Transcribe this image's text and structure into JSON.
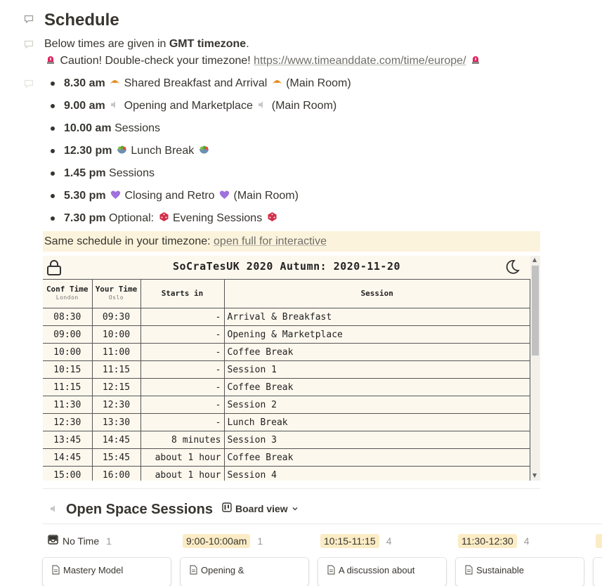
{
  "page": {
    "title": "Schedule",
    "intro_prefix": "Below times are given in ",
    "intro_bold": "GMT timezone",
    "intro_suffix": ".",
    "caution_text": "Caution! Double-check your timezone! ",
    "caution_link": "https://www.timeanddate.com/time/europe/"
  },
  "schedule": [
    {
      "time": "8.30 am",
      "pre": "",
      "text": "Shared Breakfast and Arrival",
      "icon": "croissant-icon",
      "room": "(Main Room)"
    },
    {
      "time": "9.00 am",
      "pre": "",
      "text": "Opening and Marketplace",
      "icon": "speaker-icon",
      "room": "(Main Room)"
    },
    {
      "time": "10.00 am",
      "pre": "",
      "text": "Sessions",
      "icon": "",
      "room": ""
    },
    {
      "time": "12.30 pm",
      "pre": "",
      "text": "Lunch Break",
      "icon": "salad-icon",
      "room": ""
    },
    {
      "time": "1.45 pm",
      "pre": "",
      "text": "Sessions",
      "icon": "",
      "room": ""
    },
    {
      "time": "5.30 pm",
      "pre": "",
      "text": "Closing and Retro",
      "icon": "purple-heart-icon",
      "room": "(Main Room)"
    },
    {
      "time": "7.30 pm",
      "pre": "Optional:",
      "text": "Evening Sessions",
      "icon": "dice-icon",
      "room": ""
    }
  ],
  "callout": {
    "text": "Same schedule in your timezone: ",
    "link": "open full for interactive"
  },
  "embed": {
    "title": "SoCraTesUK 2020 Autumn: 2020-11-20",
    "headers": {
      "conf_time": "Conf Time",
      "conf_sub": "London",
      "your_time": "Your Time",
      "your_sub": "Oslo",
      "starts_in": "Starts in",
      "session": "Session"
    },
    "rows": [
      {
        "conf": "08:30",
        "yours": "09:30",
        "starts": "-",
        "session": "Arrival & Breakfast"
      },
      {
        "conf": "09:00",
        "yours": "10:00",
        "starts": "-",
        "session": "Opening & Marketplace"
      },
      {
        "conf": "10:00",
        "yours": "11:00",
        "starts": "-",
        "session": "Coffee Break"
      },
      {
        "conf": "10:15",
        "yours": "11:15",
        "starts": "-",
        "session": "Session 1"
      },
      {
        "conf": "11:15",
        "yours": "12:15",
        "starts": "-",
        "session": "Coffee Break"
      },
      {
        "conf": "11:30",
        "yours": "12:30",
        "starts": "-",
        "session": "Session 2"
      },
      {
        "conf": "12:30",
        "yours": "13:30",
        "starts": "-",
        "session": "Lunch Break"
      },
      {
        "conf": "13:45",
        "yours": "14:45",
        "starts": "8 minutes",
        "session": "Session 3"
      },
      {
        "conf": "14:45",
        "yours": "15:45",
        "starts": "about 1 hour",
        "session": "Coffee Break"
      },
      {
        "conf": "15:00",
        "yours": "16:00",
        "starts": "about 1 hour",
        "session": "Session 4"
      }
    ]
  },
  "board": {
    "heading": "Open Space Sessions",
    "view_label": "Board view",
    "groups": [
      {
        "label": "No Time",
        "count": "1",
        "pill": false
      },
      {
        "label": "9:00-10:00am",
        "count": "1",
        "pill": true
      },
      {
        "label": "10:15-11:15",
        "count": "4",
        "pill": true
      },
      {
        "label": "11:30-12:30",
        "count": "4",
        "pill": true
      }
    ],
    "cards": [
      "Mastery Model",
      "Opening &",
      "A discussion about",
      "Sustainable"
    ]
  },
  "colors": {
    "accent_pill": "#fbecc5",
    "callout_bg": "#fbf3db",
    "embed_bg": "#fdf8ee"
  }
}
